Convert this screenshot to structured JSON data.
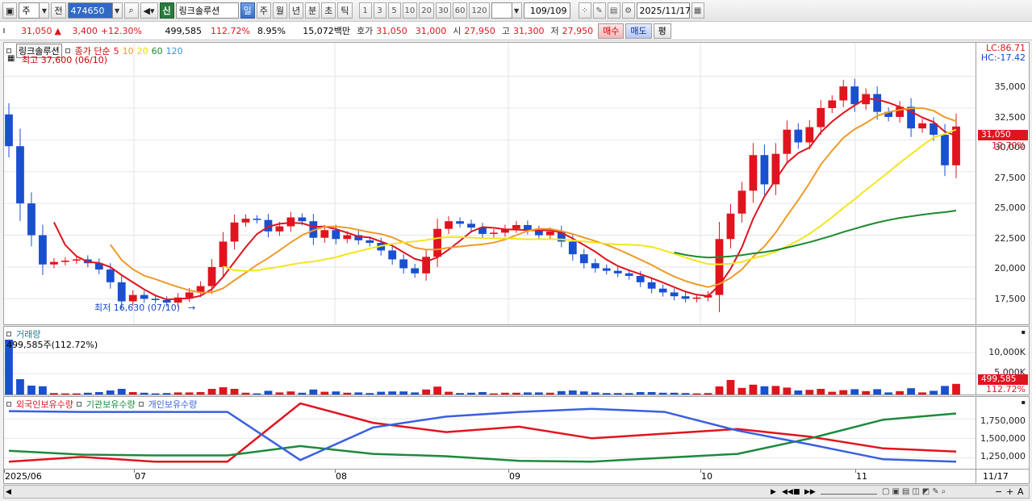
{
  "toolbar": {
    "market": "주",
    "prev_label": "전",
    "code": "474650",
    "name_badge": "신",
    "stock_name": "링크솔루션",
    "periods": [
      "일",
      "주",
      "월",
      "년",
      "분",
      "초",
      "틱"
    ],
    "active_period": "일",
    "ticks": [
      "1",
      "3",
      "5",
      "10",
      "20",
      "30",
      "60",
      "120"
    ],
    "count": "109",
    "count_total": "/109",
    "date": "2025/11/17"
  },
  "quote": {
    "price": "31,050",
    "arrow": "▲",
    "change": "3,400",
    "change_pct": "+12.30%",
    "volume": "499,585",
    "vol_ratio": "112.72%",
    "turnover": "8.95%",
    "amount": "15,072백만",
    "hoga_label": "호가",
    "hoga_sell": "31,050",
    "hoga_buy": "31,000",
    "open_label": "시",
    "open": "27,950",
    "high_label": "고",
    "high": "31,300",
    "low_label": "저",
    "low": "27,950",
    "buy_button": "매수",
    "sell_button": "매도",
    "eval_button": "평"
  },
  "price_pane": {
    "legend_name": "링크솔루션",
    "legend_type": "종가 단순",
    "ma_labels": [
      "5",
      "10",
      "20",
      "60",
      "120"
    ],
    "ma_colors": [
      "#e0141e",
      "#f09a28",
      "#f2e61e",
      "#1c8a2c",
      "#3a8fd8"
    ],
    "max_note": "최고 37,600 (06/10)",
    "min_note": "최저 16,630 (07/10)",
    "lc": "LC:86.71",
    "hc": "HC:-17.42",
    "yticks": [
      "35,000",
      "32,500",
      "30,000",
      "27,500",
      "25,000",
      "22,500",
      "20,000",
      "17,500"
    ],
    "last_price_tag": "31,050",
    "last_pct_tag": "12.70%"
  },
  "volume_pane": {
    "title": "거래량",
    "note": "499,585주(112.72%)",
    "yticks": [
      "10,000K",
      "5,000K"
    ],
    "last_tag": "499,585",
    "last_pct": "112.72%"
  },
  "holding_pane": {
    "legend": [
      "외국인보유수량",
      "기관보유수량",
      "개인보유수량"
    ],
    "colors": [
      "#e0141e",
      "#1c8a3c",
      "#3a5fe0"
    ],
    "yticks": [
      "1,750,000",
      "1,500,000",
      "1,250,000"
    ]
  },
  "xaxis": {
    "labels": [
      "2025/06",
      "07",
      "08",
      "09",
      "10",
      "11"
    ],
    "end_label": "11/17"
  },
  "chart_data": {
    "type": "candlestick",
    "ylim": [
      16000,
      37000
    ],
    "x": [
      "2025/06",
      "07",
      "08",
      "09",
      "10",
      "11"
    ],
    "candles_close": [
      29500,
      25000,
      22500,
      20200,
      20400,
      20500,
      20600,
      20300,
      19800,
      18800,
      17300,
      17800,
      17500,
      17400,
      17200,
      17600,
      18000,
      18500,
      20000,
      22000,
      23500,
      23800,
      23700,
      22800,
      23200,
      23900,
      23600,
      22300,
      22900,
      22200,
      22500,
      22100,
      21900,
      21300,
      20600,
      19900,
      19500,
      20800,
      23000,
      23600,
      23400,
      23100,
      22600,
      22700,
      23000,
      23300,
      22900,
      22500,
      22800,
      22000,
      21000,
      20300,
      19900,
      19700,
      19500,
      19300,
      18800,
      18300,
      18000,
      17700,
      17500,
      17600,
      17800,
      22200,
      24200,
      26000,
      28800,
      26500,
      28900,
      30800,
      29800,
      31000,
      32500,
      33100,
      34200,
      32800,
      33600,
      32200,
      31800,
      32600,
      30900,
      31300,
      30400,
      28000,
      31050
    ],
    "series": [
      {
        "name": "외국인보유수량",
        "values": [
          1200000,
          1260000,
          1200000,
          1200000,
          1950000,
          1700000,
          1580000,
          1650000,
          1500000,
          1560000,
          1620000,
          1520000,
          1370000,
          1330000
        ]
      },
      {
        "name": "기관보유수량",
        "values": [
          1340000,
          1290000,
          1280000,
          1280000,
          1400000,
          1300000,
          1270000,
          1210000,
          1200000,
          1250000,
          1300000,
          1500000,
          1740000,
          1820000
        ]
      },
      {
        "name": "개인보유수량",
        "values": [
          1850000,
          1840000,
          1840000,
          1840000,
          1220000,
          1640000,
          1780000,
          1840000,
          1880000,
          1840000,
          1600000,
          1420000,
          1230000,
          1200000
        ]
      }
    ]
  }
}
